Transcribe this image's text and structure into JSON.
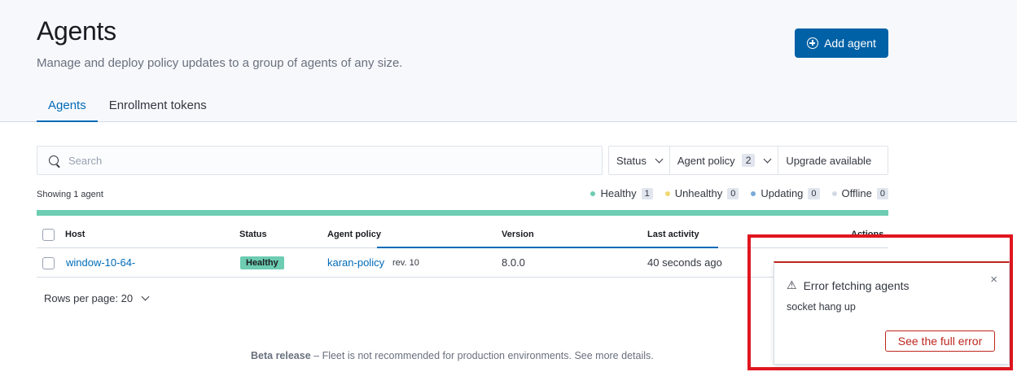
{
  "header": {
    "title": "Agents",
    "description": "Manage and deploy policy updates to a group of agents of any size.",
    "add_button_label": "Add agent"
  },
  "tabs": [
    {
      "label": "Agents",
      "active": true
    },
    {
      "label": "Enrollment tokens",
      "active": false
    }
  ],
  "search": {
    "placeholder": "Search"
  },
  "filters": {
    "status_label": "Status",
    "agent_policy_label": "Agent policy",
    "agent_policy_count": "2",
    "upgrade_label": "Upgrade available"
  },
  "summary": {
    "showing": "Showing 1 agent",
    "legend": [
      {
        "label": "Healthy",
        "count": "1",
        "color": "#6dccb1"
      },
      {
        "label": "Unhealthy",
        "count": "0",
        "color": "#f1d86f"
      },
      {
        "label": "Updating",
        "count": "0",
        "color": "#79aad9"
      },
      {
        "label": "Offline",
        "count": "0",
        "color": "#d3dae6"
      }
    ],
    "healthy_fraction": 1.0
  },
  "table": {
    "columns": {
      "host": "Host",
      "status": "Status",
      "policy": "Agent policy",
      "version": "Version",
      "last_activity": "Last activity",
      "actions": "Actions"
    },
    "rows": [
      {
        "host": "window-10-64-",
        "status": "Healthy",
        "policy": "karan-policy",
        "rev": "rev. 10",
        "version": "8.0.0",
        "last_activity": "40 seconds ago"
      }
    ]
  },
  "pagination": {
    "rows_per_page": "Rows per page: 20"
  },
  "footer": {
    "bold": "Beta release",
    "text": " – Fleet is not recommended for production environments. See more details."
  },
  "toast": {
    "title": "Error fetching agents",
    "body": "socket hang up",
    "button_label": "See the full error",
    "close_glyph": "×",
    "warning_glyph": "⚠"
  }
}
